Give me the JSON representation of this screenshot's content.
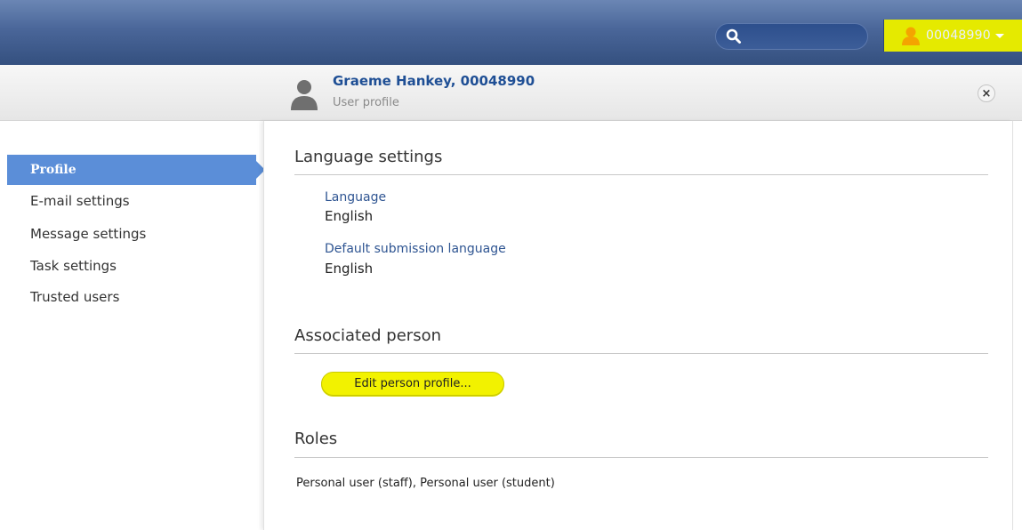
{
  "topbar": {
    "search": {
      "placeholder": ""
    },
    "user_menu": {
      "user_id": "00048990"
    }
  },
  "header": {
    "name": "Graeme Hankey, 00048990",
    "subtitle": "User profile",
    "close_label": "×"
  },
  "sidebar": {
    "items": [
      {
        "label": "Profile",
        "active": true
      },
      {
        "label": "E-mail settings"
      },
      {
        "label": "Message settings"
      },
      {
        "label": "Task settings"
      },
      {
        "label": "Trusted users"
      }
    ]
  },
  "main": {
    "language_section": {
      "title": "Language settings",
      "language_label": "Language",
      "language_value": "English",
      "default_label": "Default submission language",
      "default_value": "English"
    },
    "associated_section": {
      "title": "Associated person",
      "edit_button": "Edit person profile..."
    },
    "roles_section": {
      "title": "Roles",
      "roles_text": "Personal user (staff), Personal user (student)"
    }
  },
  "colors": {
    "topbar": "#4a6699",
    "highlight": "#e5ea00",
    "active_nav": "#5b8ed8",
    "link": "#2f5592"
  }
}
